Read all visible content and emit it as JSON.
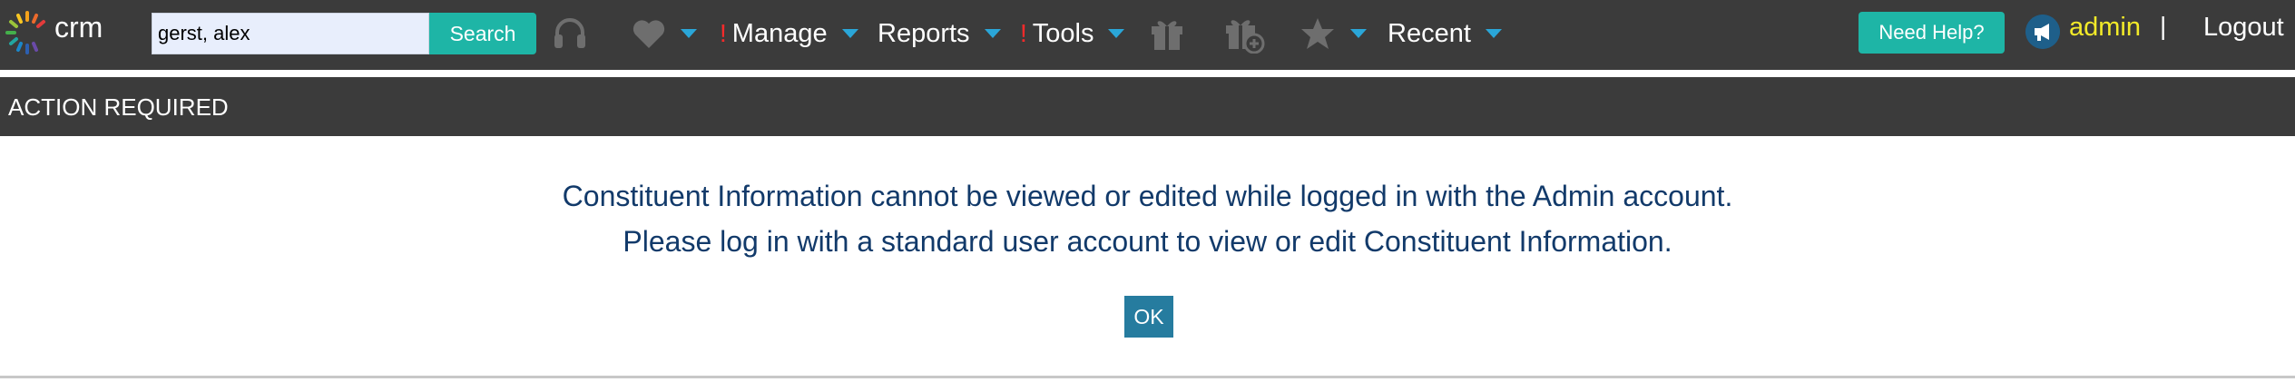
{
  "app": {
    "logo_text": "crm"
  },
  "search": {
    "value": "gerst, alex",
    "button_label": "Search"
  },
  "nav": {
    "manage_label": "Manage",
    "reports_label": "Reports",
    "tools_label": "Tools",
    "recent_label": "Recent",
    "alert_mark": "!"
  },
  "header_right": {
    "help_label": "Need Help?",
    "user_label": "admin",
    "separator": "|",
    "logout_label": "Logout"
  },
  "action": {
    "title": "ACTION REQUIRED",
    "line1": "Constituent Information cannot be viewed or edited while logged in with the Admin account.",
    "line2": "Please log in with a standard user account to view or edit Constituent Information.",
    "ok_label": "OK"
  },
  "colors": {
    "topbar_bg": "#3b3b3b",
    "accent_teal": "#1eb5a6",
    "caret_blue": "#2aa6d8",
    "alert_red": "#ff2a2a",
    "user_yellow": "#f2ea29",
    "message_text": "#123a6a",
    "ok_button": "#267c9f"
  },
  "icons": [
    "crm-logo-icon",
    "headset-icon",
    "heart-icon",
    "gift-icon",
    "gift-add-icon",
    "star-icon",
    "megaphone-icon"
  ]
}
